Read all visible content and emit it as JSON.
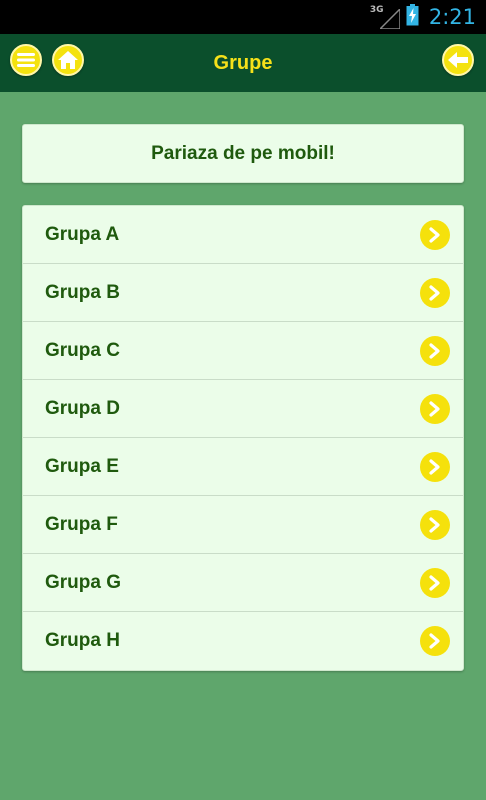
{
  "status_bar": {
    "network": "3G",
    "time": "2:21",
    "battery_icon": "battery-charging-icon",
    "signal_icon": "signal-icon"
  },
  "app_bar": {
    "title": "Grupe",
    "menu_icon": "menu-icon",
    "home_icon": "home-icon",
    "back_icon": "back-arrow-icon"
  },
  "banner": {
    "text": "Pariaza de pe mobil!"
  },
  "groups": {
    "items": [
      {
        "label": "Grupa A"
      },
      {
        "label": "Grupa B"
      },
      {
        "label": "Grupa C"
      },
      {
        "label": "Grupa D"
      },
      {
        "label": "Grupa E"
      },
      {
        "label": "Grupa F"
      },
      {
        "label": "Grupa G"
      },
      {
        "label": "Grupa H"
      }
    ]
  },
  "colors": {
    "background": "#5fa66c",
    "app_bar": "#0b4f2c",
    "accent_yellow": "#f5e10c",
    "text_green": "#1f5a0e",
    "card": "#ebfde9"
  }
}
